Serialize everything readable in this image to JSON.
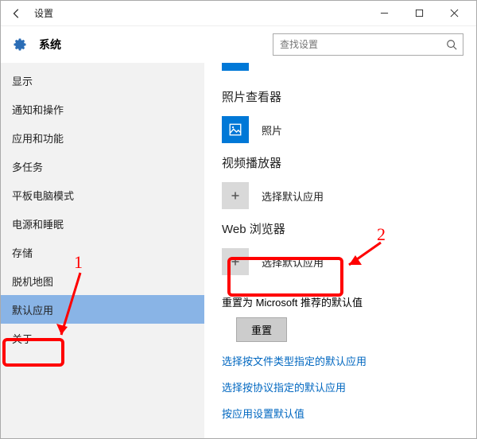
{
  "titlebar": {
    "title": "设置"
  },
  "header": {
    "title": "系统",
    "search_placeholder": "查找设置"
  },
  "sidebar": {
    "items": [
      {
        "label": "显示"
      },
      {
        "label": "通知和操作"
      },
      {
        "label": "应用和功能"
      },
      {
        "label": "多任务"
      },
      {
        "label": "平板电脑模式"
      },
      {
        "label": "电源和睡眠"
      },
      {
        "label": "存储"
      },
      {
        "label": "脱机地图"
      },
      {
        "label": "默认应用"
      },
      {
        "label": "关于"
      }
    ],
    "selected_index": 8
  },
  "main": {
    "sections": {
      "photo_viewer": {
        "title": "照片查看器",
        "item_label": "照片"
      },
      "video_player": {
        "title": "视频播放器",
        "item_label": "选择默认应用"
      },
      "web_browser": {
        "title": "Web 浏览器",
        "item_label": "选择默认应用"
      }
    },
    "reset": {
      "text": "重置为 Microsoft 推荐的默认值",
      "button": "重置"
    },
    "links": {
      "by_filetype": "选择按文件类型指定的默认应用",
      "by_protocol": "选择按协议指定的默认应用",
      "by_app": "按应用设置默认值"
    }
  },
  "annotations": {
    "label1": "1",
    "label2": "2"
  }
}
